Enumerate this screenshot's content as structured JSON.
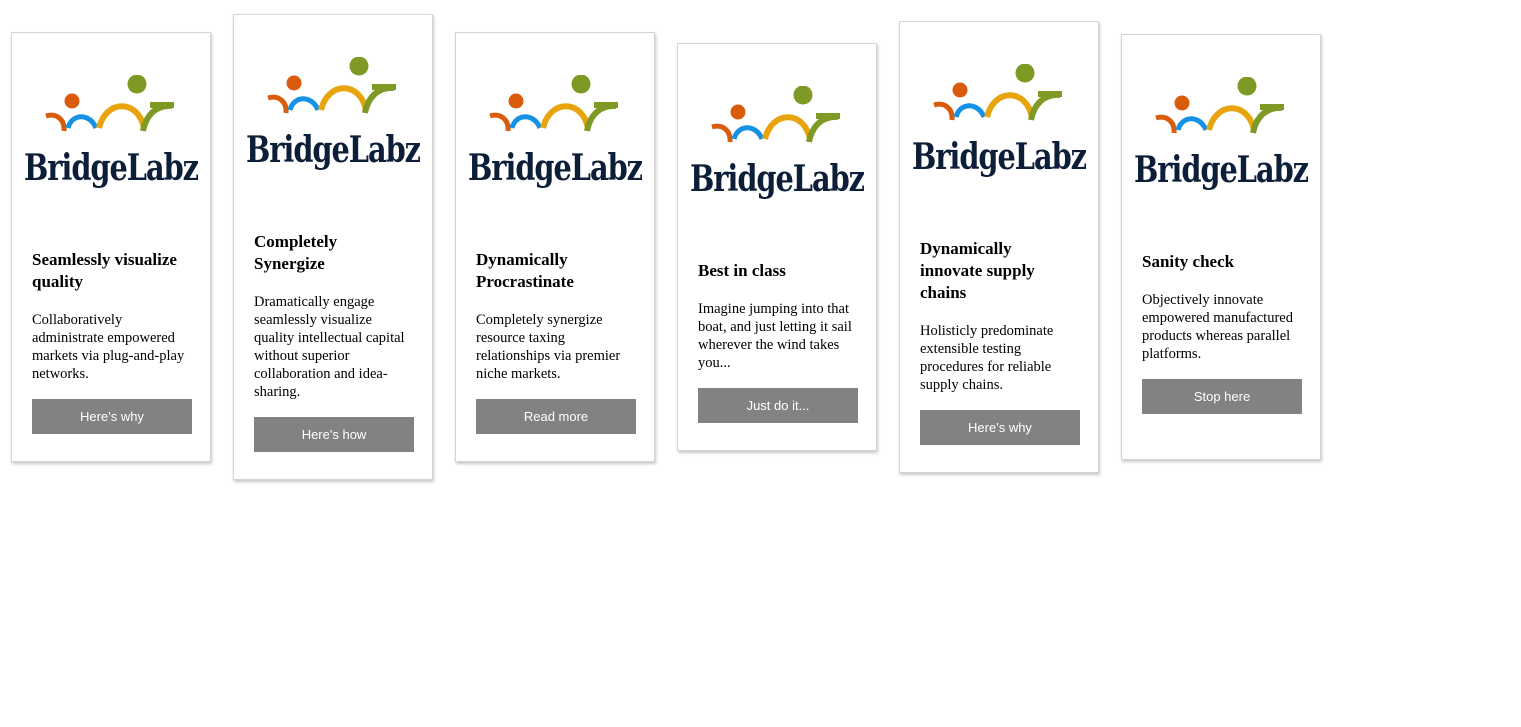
{
  "brand": {
    "logo_text": "BridgeLabz",
    "colors": {
      "orange": "#d95c0c",
      "blue": "#1591e6",
      "yellow": "#e8a40c",
      "green": "#7e9a24",
      "navy": "#0c1e38",
      "button": "#828282"
    }
  },
  "cards": [
    {
      "title": "Seamlessly visualize quality",
      "text": "Collaboratively administrate empowered markets via plug-and-play networks.",
      "button": "Here's why"
    },
    {
      "title": "Completely Synergize",
      "text": "Dramatically engage seamlessly visualize quality intellectual capital without superior collaboration and idea-sharing.",
      "button": "Here's how"
    },
    {
      "title": "Dynamically Procrastinate",
      "text": "Completely synergize resource taxing relationships via premier niche markets.",
      "button": "Read more"
    },
    {
      "title": "Best in class",
      "text": "Imagine jumping into that boat, and just letting it sail wherever the wind takes you...",
      "button": "Just do it..."
    },
    {
      "title": "Dynamically innovate supply chains",
      "text": "Holisticly predominate extensible testing procedures for reliable supply chains.",
      "button": "Here's why"
    },
    {
      "title": "Sanity check",
      "text": "Objectively innovate empowered manufactured products whereas parallel platforms.",
      "button": "Stop here"
    }
  ]
}
